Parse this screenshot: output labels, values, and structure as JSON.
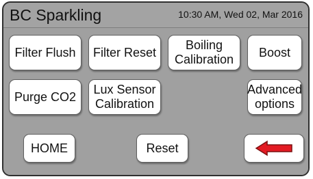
{
  "header": {
    "title": "BC Sparkling",
    "datetime": "10:30 AM, Wed 02, Mar 2016"
  },
  "buttons": {
    "filter_flush": "Filter Flush",
    "filter_reset": "Filter Reset",
    "boiling_calibration": "Boiling\nCalibration",
    "boost": "Boost",
    "purge_co2": "Purge CO2",
    "lux_sensor_calibration": "Lux Sensor\nCalibration",
    "advanced_options": "Advanced\noptions",
    "home": "HOME",
    "reset": "Reset",
    "back_icon": "left-arrow-icon"
  },
  "colors": {
    "arrow_fill": "#e31b23",
    "arrow_stroke": "#7a1111",
    "screen_background": "#a0a0a0",
    "button_background": "#ffffff"
  }
}
